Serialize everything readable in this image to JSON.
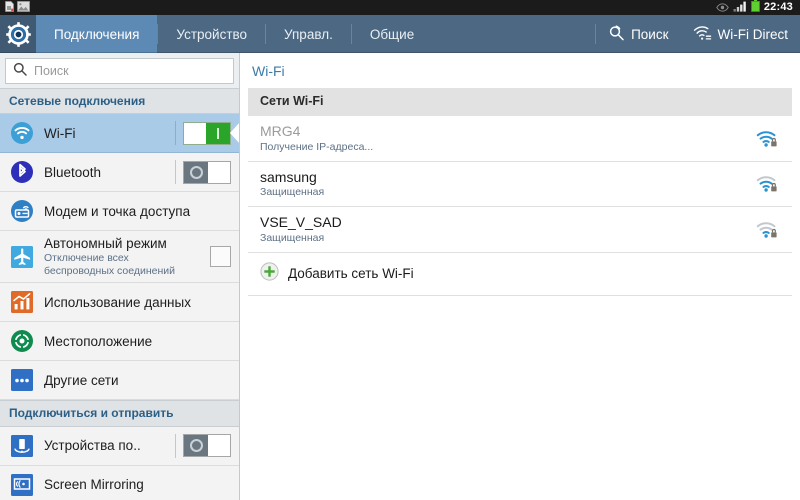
{
  "statusbar": {
    "icons": [
      "sim-card-icon",
      "screenshot-image-icon",
      "eye-icon",
      "cellular-signal-icon",
      "battery-icon"
    ],
    "time": "22:43"
  },
  "tabbar": {
    "app_icon": "settings-gear-icon",
    "tabs": [
      {
        "label": "Подключения",
        "active": true
      },
      {
        "label": "Устройство",
        "active": false
      },
      {
        "label": "Управл.",
        "active": false
      },
      {
        "label": "Общие",
        "active": false
      }
    ],
    "actions": [
      {
        "label": "Поиск",
        "icon": "scan-search-icon"
      },
      {
        "label": "Wi-Fi Direct",
        "icon": "wifi-direct-icon"
      }
    ],
    "colors": {
      "bar": "#4c6882",
      "active_tab": "#5d8ab4"
    }
  },
  "sidebar": {
    "search": {
      "placeholder": "Поиск",
      "value": "",
      "icon": "search-icon"
    },
    "sections": [
      {
        "header": "Сетевые подключения",
        "items": [
          {
            "label": "Wi-Fi",
            "sub": "",
            "icon": "wifi-icon",
            "control": "toggle",
            "state": "on",
            "selected": true
          },
          {
            "label": "Bluetooth",
            "sub": "",
            "icon": "bluetooth-icon",
            "control": "toggle",
            "state": "off",
            "selected": false
          },
          {
            "label": "Модем и точка доступа",
            "sub": "",
            "icon": "tethering-hotspot-icon",
            "control": "none",
            "state": "",
            "selected": false
          },
          {
            "label": "Автономный режим",
            "sub": "Отключение всех\nбеспроводных соединений",
            "icon": "airplane-icon",
            "control": "checkbox",
            "state": "unchecked",
            "selected": false
          },
          {
            "label": "Использование данных",
            "sub": "",
            "icon": "data-usage-chart-icon",
            "control": "none",
            "state": "",
            "selected": false
          },
          {
            "label": "Местоположение",
            "sub": "",
            "icon": "location-target-icon",
            "control": "none",
            "state": "",
            "selected": false
          },
          {
            "label": "Другие сети",
            "sub": "",
            "icon": "more-networks-icon",
            "control": "none",
            "state": "",
            "selected": false
          }
        ]
      },
      {
        "header": "Подключиться и отправить",
        "items": [
          {
            "label": "Устройства по..",
            "sub": "",
            "icon": "nearby-devices-icon",
            "control": "toggle",
            "state": "off",
            "selected": false
          },
          {
            "label": "Screen Mirroring",
            "sub": "",
            "icon": "screen-mirroring-icon",
            "control": "none",
            "state": "",
            "selected": false
          }
        ]
      }
    ],
    "colors": {
      "background": "#f3f3f3",
      "selected_row": "#a9cbe8",
      "section_header": "#dfe3e6"
    }
  },
  "main": {
    "title": "Wi-Fi",
    "list_header": "Сети Wi-Fi",
    "networks": [
      {
        "name": "MRG4",
        "status": "Получение IP-адреса...",
        "icon": "wifi-secured-icon",
        "signal": 3,
        "connecting": true
      },
      {
        "name": "samsung",
        "status": "Защищенная",
        "icon": "wifi-secured-icon",
        "signal": 2,
        "connecting": false
      },
      {
        "name": "VSE_V_SAD",
        "status": "Защищенная",
        "icon": "wifi-secured-icon",
        "signal": 1,
        "connecting": false
      }
    ],
    "add_network": {
      "label": "Добавить сеть Wi-Fi",
      "icon": "plus-circle-icon"
    }
  }
}
